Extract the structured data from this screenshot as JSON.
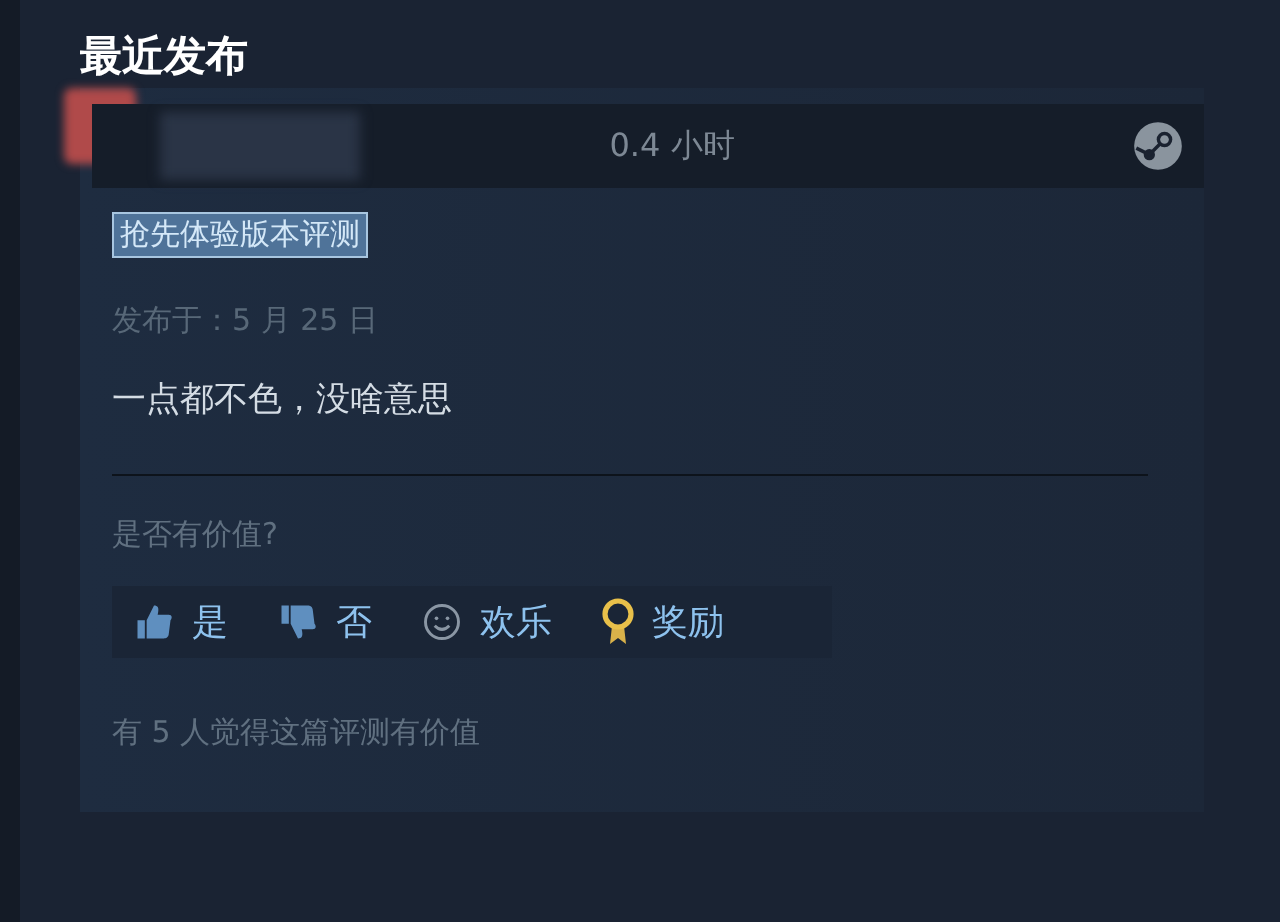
{
  "section_title": "最近发布",
  "review": {
    "playtime": "0.4 小时",
    "tag": "抢先体验版本评测",
    "posted": "发布于：5 月 25 日",
    "text": "一点都不色，没啥意思",
    "helpful_prompt": "是否有价值?",
    "actions": [
      {
        "kind": "thumb-up",
        "label": "是"
      },
      {
        "kind": "thumb-down",
        "label": "否"
      },
      {
        "kind": "smile",
        "label": "欢乐"
      },
      {
        "kind": "award",
        "label": "奖励"
      }
    ],
    "helpful_count": "有 5 人觉得这篇评测有价值"
  }
}
